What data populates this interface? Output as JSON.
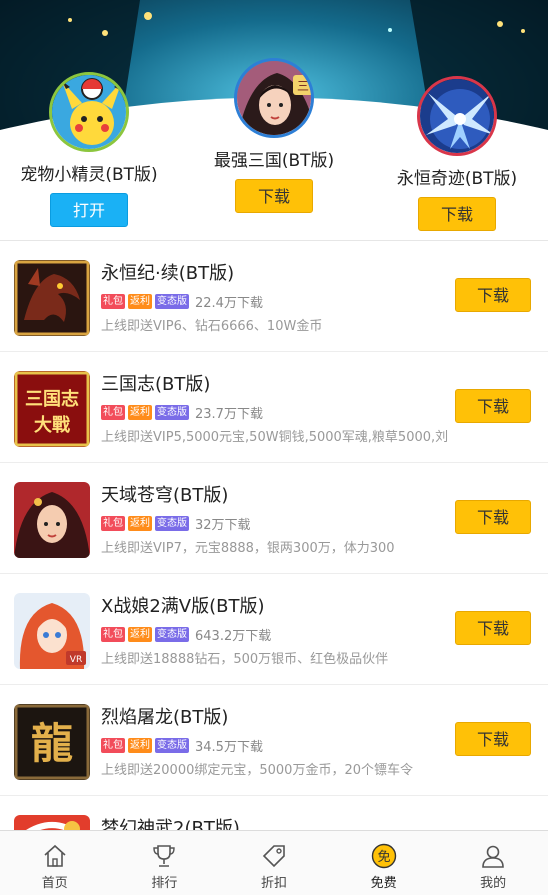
{
  "featured": [
    {
      "name": "宠物小精灵(BT版)",
      "button": "打开"
    },
    {
      "name": "最强三国(BT版)",
      "button": "下载"
    },
    {
      "name": "永恒奇迹(BT版)",
      "button": "下载"
    }
  ],
  "tags": {
    "gift": "礼包",
    "rebate": "返利",
    "mod": "变态版"
  },
  "games": [
    {
      "title": "永恒纪·续(BT版)",
      "downloads": "22.4万下载",
      "desc": "上线即送VIP6、钻石6666、10W金币",
      "button": "下载"
    },
    {
      "title": "三国志(BT版)",
      "downloads": "23.7万下载",
      "desc": "上线即送VIP5,5000元宝,50W铜钱,5000军魂,粮草5000,刘",
      "button": "下载"
    },
    {
      "title": "天域苍穹(BT版)",
      "downloads": "32万下载",
      "desc": "上线即送VIP7，元宝8888，银两300万，体力300",
      "button": "下载"
    },
    {
      "title": "X战娘2满V版(BT版)",
      "downloads": "643.2万下载",
      "desc": "上线即送18888钻石，500万银币、红色极品伙伴",
      "button": "下载"
    },
    {
      "title": "烈焰屠龙(BT版)",
      "downloads": "34.5万下载",
      "desc": "上线即送20000绑定元宝，5000万金币，20个镖车令",
      "button": "下载"
    },
    {
      "title": "梦幻神武2(BT版)"
    }
  ],
  "tabs": [
    {
      "label": "首页"
    },
    {
      "label": "排行"
    },
    {
      "label": "折扣"
    },
    {
      "label": "免费",
      "badge": "免"
    },
    {
      "label": "我的"
    }
  ],
  "colors": {
    "download_button": "#ffc107",
    "open_button": "#1ab1f5",
    "tag_gift": "#f24c5a",
    "tag_rebate": "#ff8c1a",
    "tag_mod": "#7a6ce8"
  }
}
